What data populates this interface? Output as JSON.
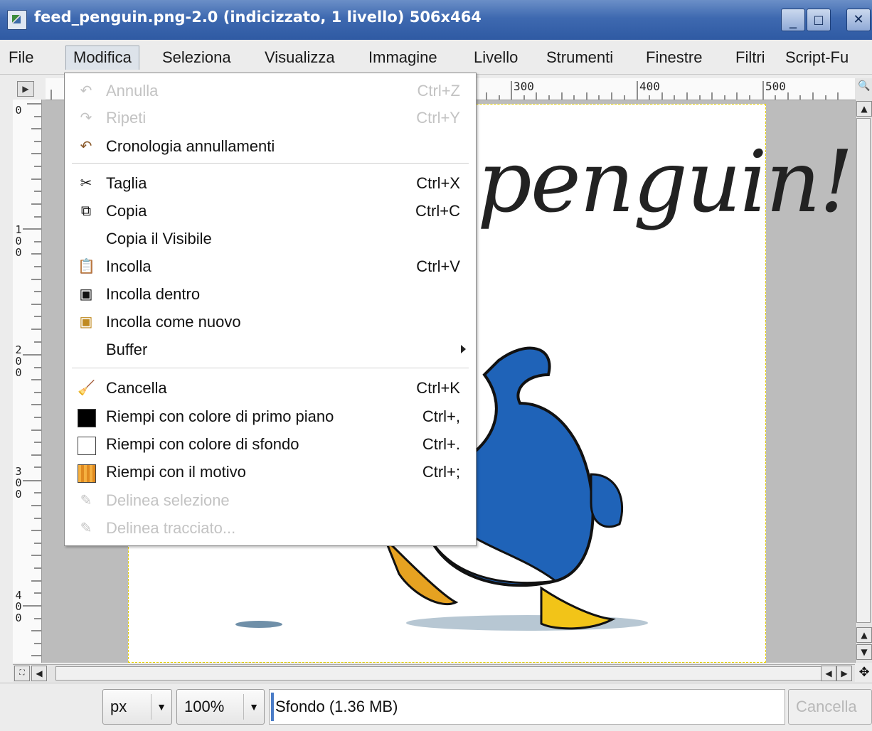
{
  "window": {
    "title": "feed_penguin.png-2.0 (indicizzato, 1 livello) 506x464"
  },
  "window_controls": {
    "minimize": "_",
    "maximize": "□",
    "close": "✕"
  },
  "menubar": {
    "items": [
      {
        "label": "File"
      },
      {
        "label": "Modifica"
      },
      {
        "label": "Seleziona"
      },
      {
        "label": "Visualizza"
      },
      {
        "label": "Immagine"
      },
      {
        "label": "Livello"
      },
      {
        "label": "Strumenti"
      },
      {
        "label": "Finestre"
      },
      {
        "label": "Filtri"
      },
      {
        "label": "Script-Fu"
      }
    ]
  },
  "rulers": {
    "top_labels": [
      "300",
      "400",
      "500"
    ],
    "left_labels": [
      [
        "0"
      ],
      [
        "1",
        "0",
        "0"
      ],
      [
        "2",
        "0",
        "0"
      ],
      [
        "3",
        "0",
        "0"
      ],
      [
        "4",
        "0",
        "0"
      ]
    ]
  },
  "image": {
    "caption": "penguin!"
  },
  "dropdown": {
    "items": [
      {
        "label": "Annulla",
        "shortcut": "Ctrl+Z",
        "icon": "undo-icon",
        "disabled": true
      },
      {
        "label": "Ripeti",
        "shortcut": "Ctrl+Y",
        "icon": "redo-icon",
        "disabled": true
      },
      {
        "label": "Cronologia annullamenti",
        "shortcut": "",
        "icon": "undo-history-icon",
        "disabled": false
      },
      {
        "label": "Taglia",
        "shortcut": "Ctrl+X",
        "icon": "cut-icon",
        "disabled": false
      },
      {
        "label": "Copia",
        "shortcut": "Ctrl+C",
        "icon": "copy-icon",
        "disabled": false
      },
      {
        "label": "Copia il Visibile",
        "shortcut": "",
        "icon": "",
        "disabled": false
      },
      {
        "label": "Incolla",
        "shortcut": "Ctrl+V",
        "icon": "paste-icon",
        "disabled": false
      },
      {
        "label": "Incolla dentro",
        "shortcut": "",
        "icon": "paste-into-icon",
        "disabled": false
      },
      {
        "label": "Incolla come nuovo",
        "shortcut": "",
        "icon": "paste-as-new-icon",
        "disabled": false
      },
      {
        "label": "Buffer",
        "shortcut": "",
        "icon": "",
        "disabled": false,
        "submenu": true
      },
      {
        "label": "Cancella",
        "shortcut": "Ctrl+K",
        "icon": "clear-icon",
        "disabled": false
      },
      {
        "label": "Riempi con colore di primo piano",
        "shortcut": "Ctrl+,",
        "icon": "fg-color-swatch",
        "disabled": false
      },
      {
        "label": "Riempi con colore di sfondo",
        "shortcut": "Ctrl+.",
        "icon": "bg-color-swatch",
        "disabled": false
      },
      {
        "label": "Riempi con il motivo",
        "shortcut": "Ctrl+;",
        "icon": "pattern-swatch",
        "disabled": false
      },
      {
        "label": "Delinea selezione",
        "shortcut": "",
        "icon": "stroke-selection-icon",
        "disabled": true
      },
      {
        "label": "Delinea tracciato...",
        "shortcut": "",
        "icon": "stroke-path-icon",
        "disabled": true
      }
    ]
  },
  "colors": {
    "foreground_swatch": "#000000",
    "background_swatch": "#ffffff",
    "pattern_swatch": "#f0a030",
    "penguin_blue": "#1f63b8"
  },
  "statusbar": {
    "unit": "px",
    "zoom": "100%",
    "layer_info": "Sfondo (1.36 MB)",
    "cancel_label": "Cancella"
  }
}
